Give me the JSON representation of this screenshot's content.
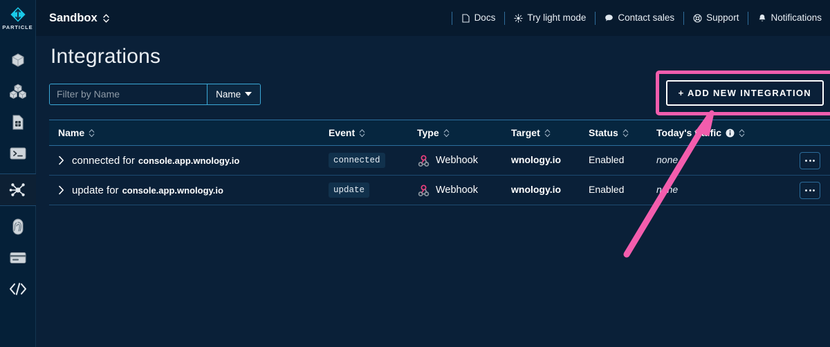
{
  "sidebar": {
    "logo": {
      "icon": "particle-logo-icon",
      "wordmark": "PARTICLE"
    },
    "items": [
      {
        "icon": "cube-icon",
        "name": "devices",
        "active": false
      },
      {
        "icon": "cubes-icon",
        "name": "products",
        "active": false
      },
      {
        "icon": "sim-card-icon",
        "name": "sim-cards",
        "active": false
      },
      {
        "icon": "console-icon",
        "name": "console",
        "active": false
      },
      {
        "icon": "integrations-icon",
        "name": "integrations",
        "active": true
      },
      {
        "icon": "fingerprint-icon",
        "name": "authentication",
        "active": false
      },
      {
        "icon": "credit-card-icon",
        "name": "billing",
        "active": false
      },
      {
        "icon": "code-icon",
        "name": "developer-tools",
        "active": false
      }
    ]
  },
  "topbar": {
    "workspace": "Sandbox",
    "nav": [
      {
        "icon": "document-icon",
        "label": "Docs"
      },
      {
        "icon": "sun-icon",
        "label": "Try light mode"
      },
      {
        "icon": "chat-icon",
        "label": "Contact sales"
      },
      {
        "icon": "lifebuoy-icon",
        "label": "Support"
      },
      {
        "icon": "bell-icon",
        "label": "Notifications"
      }
    ]
  },
  "page": {
    "title": "Integrations"
  },
  "toolbar": {
    "filter_placeholder": "Filter by Name",
    "filter_value": "",
    "filter_field": "Name",
    "add_button": "+ ADD NEW INTEGRATION"
  },
  "table": {
    "columns": [
      {
        "label": "Name",
        "sortable": true
      },
      {
        "label": "Event",
        "sortable": true
      },
      {
        "label": "Type",
        "sortable": true
      },
      {
        "label": "Target",
        "sortable": true
      },
      {
        "label": "Status",
        "sortable": true
      },
      {
        "label": "Today's traffic",
        "sortable": true,
        "info": true
      }
    ],
    "rows": [
      {
        "name_prefix": "connected for",
        "name_host": "console.app.wnology.io",
        "event": "connected",
        "type": "Webhook",
        "type_icon": "webhook-icon",
        "target": "wnology.io",
        "status": "Enabled",
        "traffic": "none"
      },
      {
        "name_prefix": "update for",
        "name_host": "console.app.wnology.io",
        "event": "update",
        "type": "Webhook",
        "type_icon": "webhook-icon",
        "target": "wnology.io",
        "status": "Enabled",
        "traffic": "none"
      }
    ]
  },
  "annotation": {
    "type": "arrow",
    "color": "#f35dad",
    "points_to": "add-new-integration-button"
  },
  "colors": {
    "background": "#0a2038",
    "sidebar": "#052038",
    "topbar": "#071a2e",
    "accent_cyan": "#3ba9d8",
    "accent_pink": "#f35dad",
    "table_header": "#06263f",
    "border_blue": "#1d4a70"
  }
}
